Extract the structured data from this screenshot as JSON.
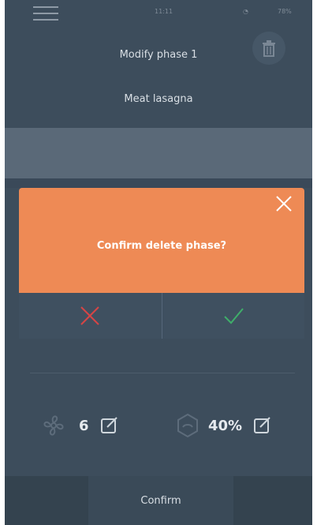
{
  "status_bar": {
    "time": "11:11",
    "signal": "◔",
    "battery": "78%"
  },
  "header": {
    "title": "Modify phase 1",
    "subtitle": "Meat lasagna"
  },
  "dialog": {
    "message": "Confirm delete phase?"
  },
  "stats": {
    "fan_value": "6",
    "humidity_value": "40%"
  },
  "footer": {
    "confirm_label": "Confirm"
  },
  "colors": {
    "background": "#3d4d5c",
    "dialog": "#ee8a55",
    "cancel": "#d64545",
    "ok": "#3fae6a"
  }
}
